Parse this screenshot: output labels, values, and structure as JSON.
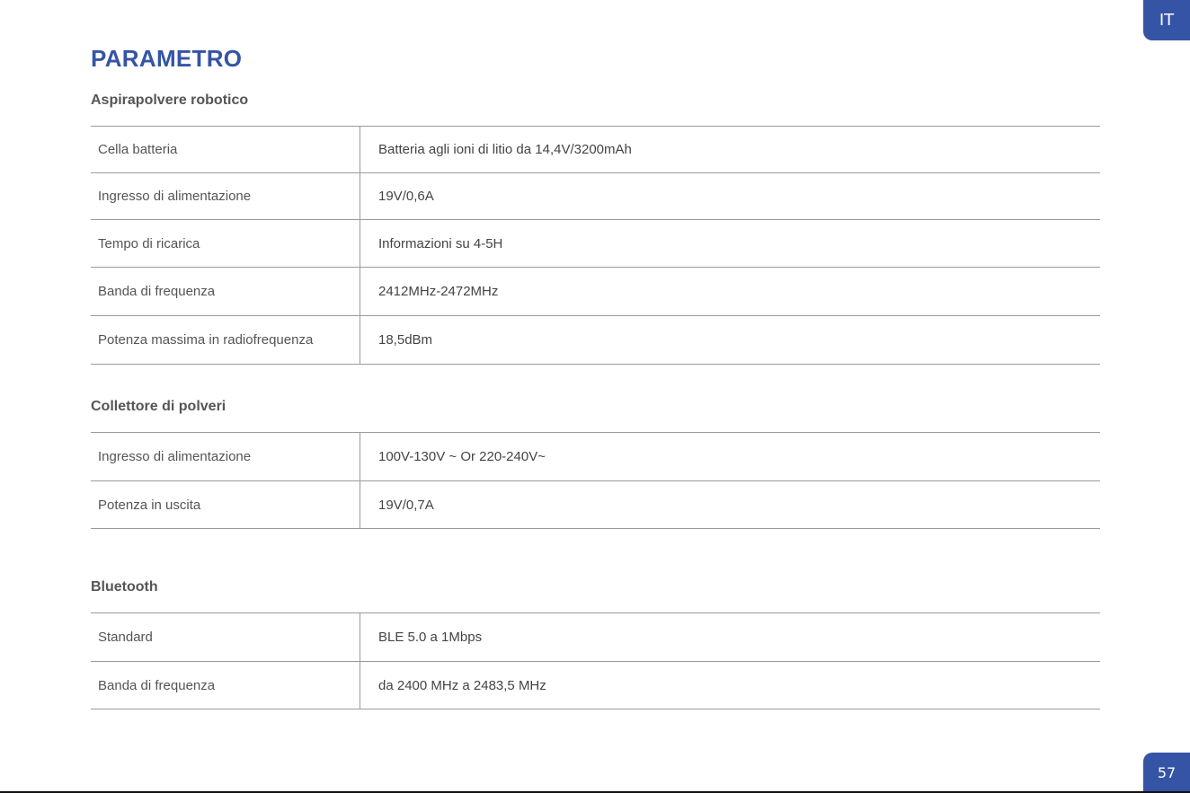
{
  "lang_tab": "IT",
  "page_number": "57",
  "title": "PARAMETRO",
  "sections": [
    {
      "heading": "Aspirapolvere robotico",
      "rows": [
        {
          "label": "Cella batteria",
          "value": "Batteria agli ioni di litio da 14,4V/3200mAh"
        },
        {
          "label": "Ingresso di alimentazione",
          "value": "19V/0,6A"
        },
        {
          "label": "Tempo di ricarica",
          "value": "Informazioni su 4-5H"
        },
        {
          "label": "Banda di frequenza",
          "value": "2412MHz-2472MHz"
        },
        {
          "label": "Potenza massima in radiofrequenza",
          "value": "18,5dBm"
        }
      ]
    },
    {
      "heading": "Collettore di polveri",
      "rows": [
        {
          "label": "Ingresso di alimentazione",
          "value": "100V-130V ~ Or 220-240V~"
        },
        {
          "label": "Potenza in uscita",
          "value": "19V/0,7A"
        }
      ]
    },
    {
      "heading": "Bluetooth",
      "rows": [
        {
          "label": "Standard",
          "value": "BLE 5.0 a 1Mbps"
        },
        {
          "label": "Banda di frequenza",
          "value": "da 2400 MHz a 2483,5 MHz"
        }
      ]
    }
  ]
}
